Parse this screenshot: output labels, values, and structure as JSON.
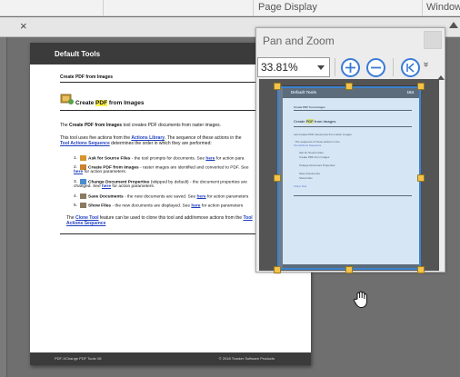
{
  "menubar": {
    "page_display_label": "Page Display",
    "window_label": "Window"
  },
  "tabbar": {
    "close_glyph": "×"
  },
  "document": {
    "header_title": "Default Tools",
    "section_heading": "Create PDF from Images",
    "big_title_pre": "Create ",
    "big_title_hl": "PDF",
    "big_title_post": " from Images",
    "p1_pre": "The ",
    "p1_bold": "Create PDF from Images",
    "p1_post": " tool creates PDF documents from raster images.",
    "p2_a": "This tool uses five actions from the ",
    "p2_link1": "Actions Library",
    "p2_b": ". The sequence of these actions in the",
    "p2_link2": "Tool Actions Sequence",
    "p2_c": " determines the order in which they are performed:",
    "items": [
      {
        "n": "1.",
        "bold": "Ask for Source Files",
        "text": " - the tool prompts for documents. See ",
        "link": "here",
        "tail": " for action para"
      },
      {
        "n": "2.",
        "bold": "Create PDF from Images",
        "text": " - raster images are identified and converted to PDF. See",
        "link": "",
        "tail": ""
      },
      {
        "n": "",
        "bold": "",
        "text": "",
        "link": "here",
        "tail": " for action parameters."
      },
      {
        "n": "3.",
        "bold": "Change Document Properties",
        "text": " (skipped by default) - the document properties are",
        "link": "",
        "tail": ""
      },
      {
        "n": "",
        "bold": "",
        "text": "changed. See ",
        "link": "here",
        "tail": " for action parameters."
      },
      {
        "n": "4.",
        "bold": "Save Documents",
        "text": " - the new documents are saved. See ",
        "link": "here",
        "tail": " for action parameters"
      },
      {
        "n": "5.",
        "bold": "Show Files",
        "text": " - the new documents are displayed. See ",
        "link": "here",
        "tail": " for action parameters"
      }
    ],
    "p3_a": "The ",
    "p3_link": "Clone Tool",
    "p3_b": " feature can be used to clone this tool and add/remove actions from the ",
    "p3_link2": "Tool",
    "p3_link3": "Actions Sequence",
    "footer_left": "PDF-XChange PDF Tools V8",
    "footer_right": "© 2018 Tracker Software Products"
  },
  "pan_zoom": {
    "title": "Pan and Zoom",
    "zoom_value": "33.81%",
    "chevron_glyph": "»"
  },
  "thumbnail": {
    "header_title": "Default Tools",
    "page_num": "164"
  },
  "colors": {
    "accent": "#3b83d1",
    "highlight": "#fff34a",
    "link": "#1f3fbf",
    "page_header": "#3b3b3b"
  }
}
